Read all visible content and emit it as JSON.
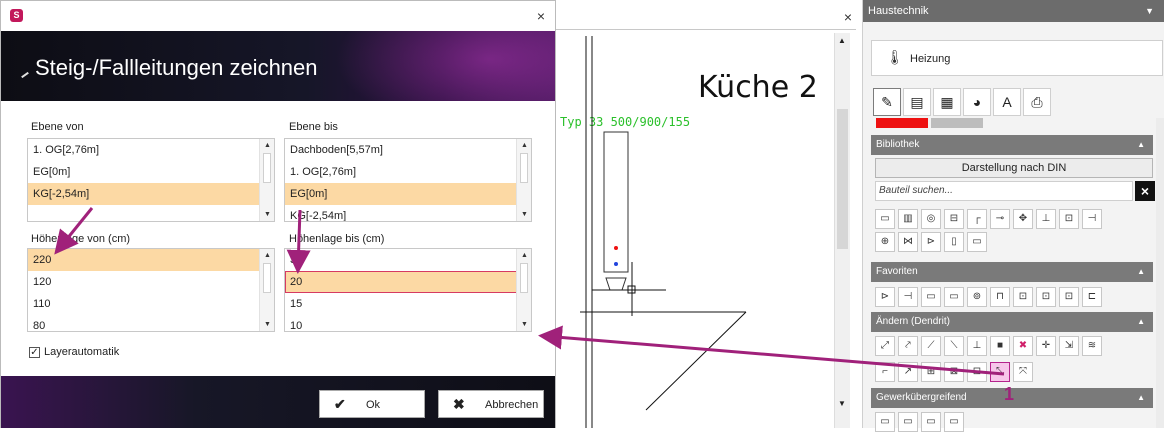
{
  "cad": {
    "close_glyph": "×",
    "room_label": "Küche 2",
    "typ_label": "Typ 33 500/900/155"
  },
  "dialog": {
    "logo_glyph": "S",
    "close_glyph": "×",
    "title": "Steig-/Fallleitungen zeichnen",
    "ebene_von": {
      "label": "Ebene von",
      "items": [
        "1. OG[2,76m]",
        "EG[0m]",
        "KG[-2,54m]"
      ],
      "selected": "KG[-2,54m]"
    },
    "ebene_bis": {
      "label": "Ebene bis",
      "items": [
        "Dachboden[5,57m]",
        "1. OG[2,76m]",
        "EG[0m]",
        "KG[-2,54m]"
      ],
      "selected": "EG[0m]"
    },
    "hoehe_von": {
      "label": "Höhenlage von (cm)",
      "items": [
        "220",
        "120",
        "110",
        "80"
      ],
      "selected": "220"
    },
    "hoehe_bis": {
      "label": "Höhenlage bis (cm)",
      "items": [
        "30",
        "20",
        "15",
        "10"
      ],
      "selected": "20"
    },
    "layerautomatik": {
      "label": "Layerautomatik",
      "checked": true,
      "glyph": "✓"
    },
    "ok_label": "Ok",
    "ok_glyph": "✔",
    "cancel_label": "Abbrechen",
    "cancel_glyph": "✖"
  },
  "panel": {
    "header": "Haustechnik",
    "header_arrow": "▼",
    "discipline": "Heizung",
    "discipline_icon": "radiator-icon",
    "tabs": [
      "pencil-icon",
      "list-icon",
      "calculator-icon",
      "pie-chart-icon",
      "text-style-icon",
      "printer-icon"
    ],
    "tab_glyphs": [
      "✎",
      "▤",
      "▦",
      "◕",
      "A",
      "⎙"
    ],
    "bibliothek": "Bibliothek",
    "din_button": "Darstellung nach DIN",
    "search_placeholder": "Bauteil suchen...",
    "search_clear": "×",
    "favoriten": "Favoriten",
    "aendern": "Ändern (Dendrit)",
    "gewerk": "Gewerkübergreifend",
    "section_arrow": "▲",
    "badge": "1"
  },
  "colors": {
    "accent": "#a0217a",
    "selection": "#fcd9a4",
    "highlight": "#f7c6ea"
  }
}
